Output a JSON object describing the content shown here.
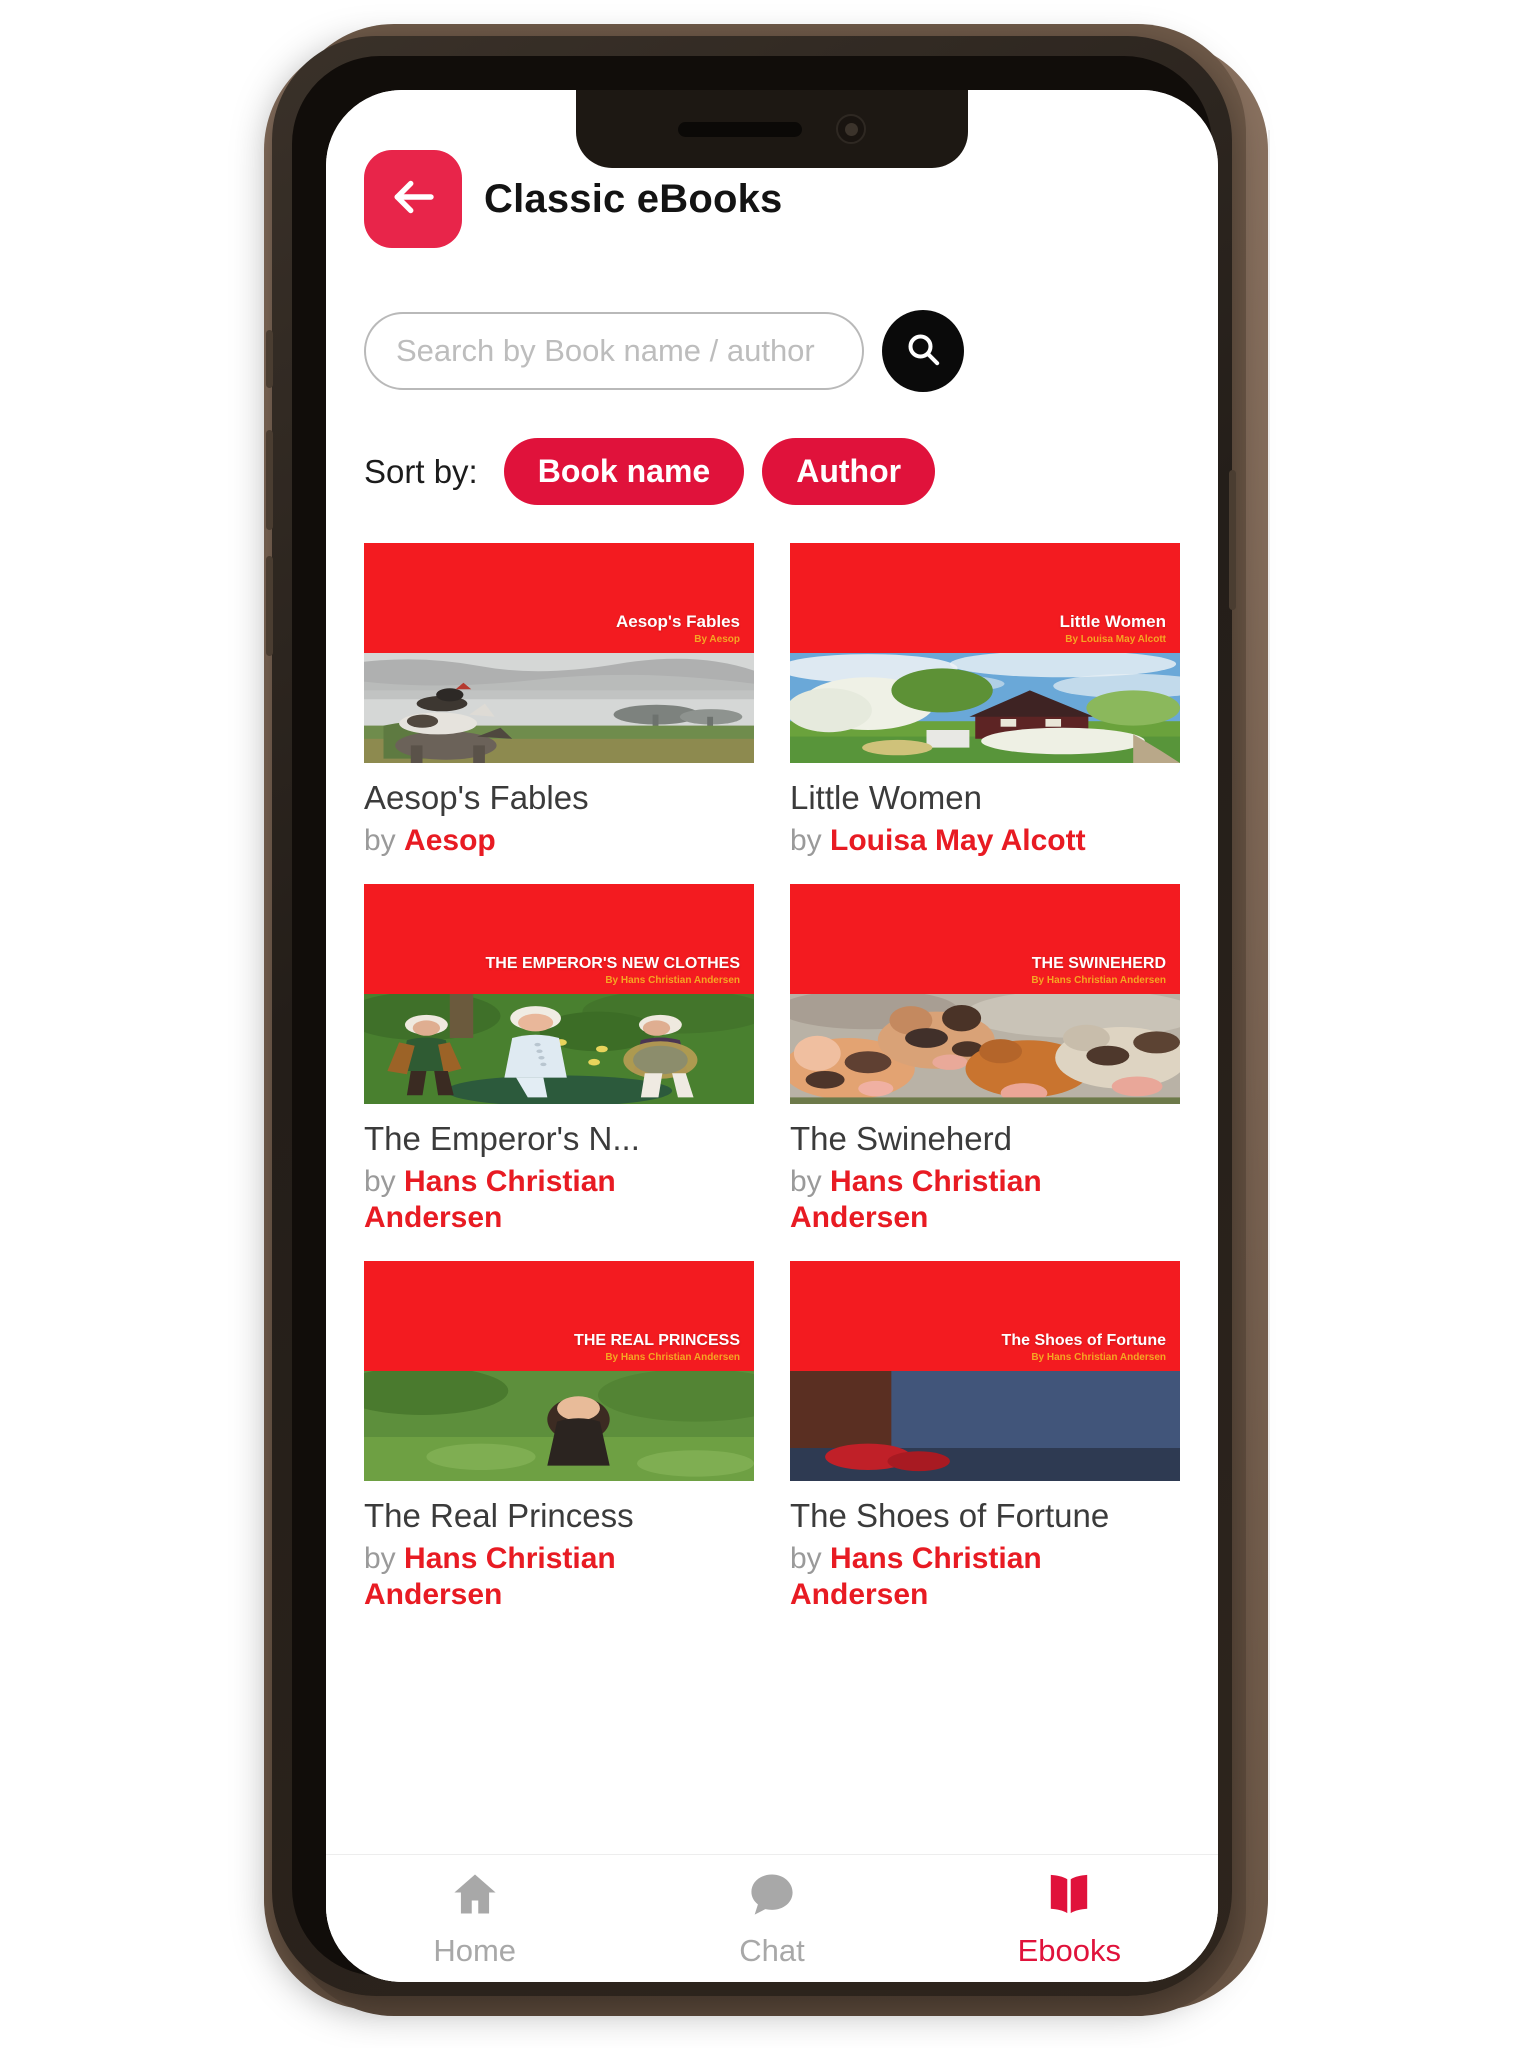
{
  "header": {
    "title": "Classic eBooks",
    "back_icon": "arrow-left-icon"
  },
  "search": {
    "placeholder": "Search by Book name / author",
    "value": "",
    "button_icon": "search-icon"
  },
  "sort": {
    "label": "Sort by:",
    "options": [
      {
        "label": "Book name"
      },
      {
        "label": "Author"
      }
    ]
  },
  "books": [
    {
      "title": "Aesop's Fables",
      "by_prefix": "by",
      "author": "Aesop",
      "cover_title": "Aesop's Fables",
      "cover_subtitle": "By Aesop",
      "cover_title_size": "17px",
      "scene": "farm-animals"
    },
    {
      "title": "Little Women",
      "by_prefix": "by",
      "author": "Louisa May Alcott",
      "cover_title": "Little Women",
      "cover_subtitle": "By Louisa May Alcott",
      "cover_title_size": "17px",
      "scene": "spring-cottage"
    },
    {
      "title": "The Emperor's N...",
      "by_prefix": "by",
      "author": "Hans Christian Andersen",
      "cover_title": "THE EMPEROR'S NEW CLOTHES",
      "cover_subtitle": "By Hans Christian Andersen",
      "cover_title_size": "16px",
      "scene": "figurines"
    },
    {
      "title": "The Swineherd",
      "by_prefix": "by",
      "author": "Hans Christian Andersen",
      "cover_title": "THE SWINEHERD",
      "cover_subtitle": "By Hans Christian Andersen",
      "cover_title_size": "16px",
      "scene": "piglets"
    },
    {
      "title": "The Real Princess",
      "by_prefix": "by",
      "author": "Hans Christian Andersen",
      "cover_title": "THE REAL PRINCESS",
      "cover_subtitle": "By Hans Christian Andersen",
      "cover_title_size": "16px",
      "scene": "princess-field"
    },
    {
      "title": "The Shoes of Fortune",
      "by_prefix": "by",
      "author": "Hans Christian Andersen",
      "cover_title": "The Shoes of Fortune",
      "cover_subtitle": "By Hans Christian Andersen",
      "cover_title_size": "16px",
      "scene": "shoes-room"
    }
  ],
  "bottom_nav": [
    {
      "label": "Home",
      "icon": "home-icon",
      "active": false
    },
    {
      "label": "Chat",
      "icon": "chat-icon",
      "active": false
    },
    {
      "label": "Ebooks",
      "icon": "book-icon",
      "active": true
    }
  ],
  "colors": {
    "brand_red": "#E0123B",
    "cover_red": "#F31B20",
    "author_red": "#E81B23",
    "accent_orange": "#F5A623",
    "nav_inactive": "#a8a8a8",
    "text_dark": "#3b3b3b"
  }
}
